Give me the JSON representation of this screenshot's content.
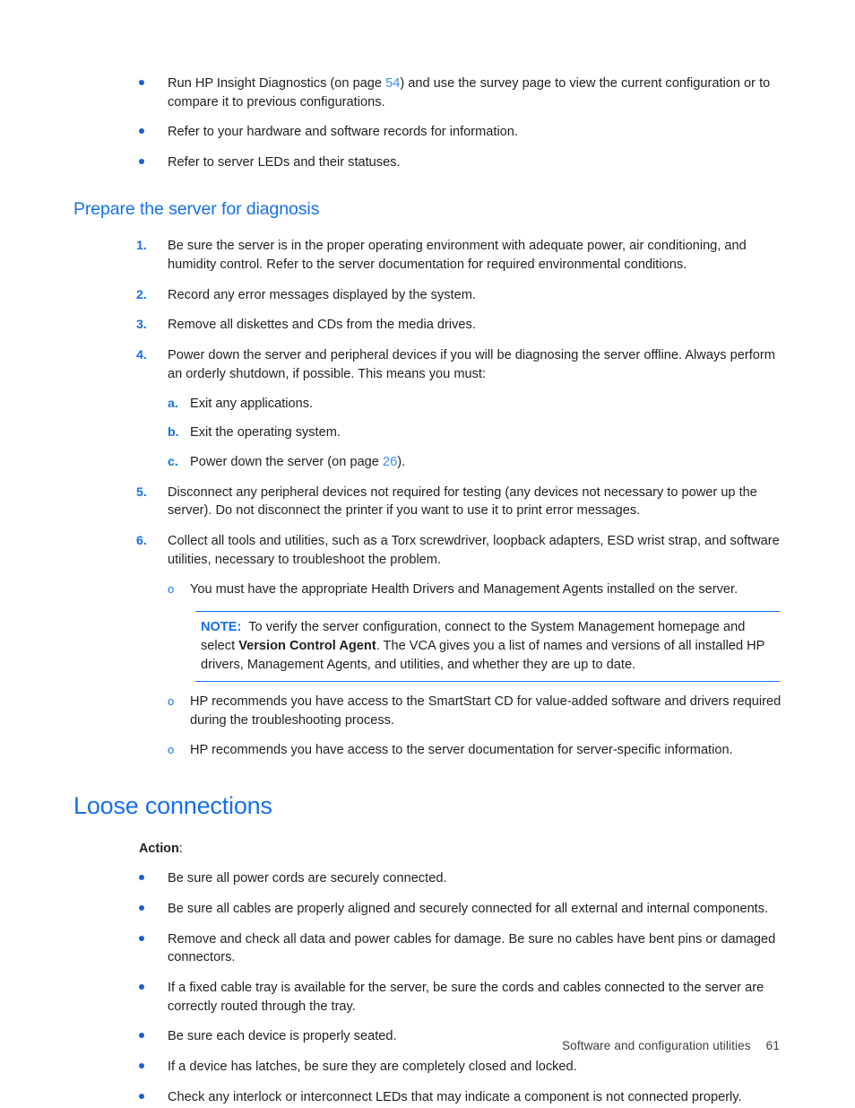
{
  "document": {
    "top_bullets": [
      {
        "pre": "Run HP Insight Diagnostics (on page ",
        "link": "54",
        "post": ") and use the survey page to view the current configuration or to compare it to previous configurations."
      },
      {
        "text": "Refer to your hardware and software records for information."
      },
      {
        "text": "Refer to server LEDs and their statuses."
      }
    ],
    "section_prepare": {
      "heading": "Prepare the server for diagnosis",
      "steps": [
        {
          "marker": "1.",
          "text": "Be sure the server is in the proper operating environment with adequate power, air conditioning, and humidity control. Refer to the server documentation for required environmental conditions."
        },
        {
          "marker": "2.",
          "text": "Record any error messages displayed by the system."
        },
        {
          "marker": "3.",
          "text": "Remove all diskettes and CDs from the media drives."
        },
        {
          "marker": "4.",
          "text": "Power down the server and peripheral devices if you will be diagnosing the server offline. Always perform an orderly shutdown, if possible. This means you must:"
        }
      ],
      "substeps": [
        {
          "marker": "a.",
          "text": "Exit any applications."
        },
        {
          "marker": "b.",
          "text": "Exit the operating system."
        },
        {
          "marker": "c.",
          "pre": "Power down the server (on page ",
          "link": "26",
          "post": ")."
        }
      ],
      "step5": {
        "marker": "5.",
        "text": "Disconnect any peripheral devices not required for testing (any devices not necessary to power up the server). Do not disconnect the printer if you want to use it to print error messages."
      },
      "step6": {
        "marker": "6.",
        "text": "Collect all tools and utilities, such as a Torx screwdriver, loopback adapters, ESD wrist strap, and software utilities, necessary to troubleshoot the problem."
      },
      "sub_bullet_1": {
        "marker": "o",
        "text": "You must have the appropriate Health Drivers and Management Agents installed on the server."
      },
      "note": {
        "label": "NOTE:",
        "part1": "To verify the server configuration, connect to the System Management homepage and select ",
        "bold": "Version Control Agent",
        "part2": ". The VCA gives you a list of names and versions of all installed HP drivers, Management Agents, and utilities, and whether they are up to date."
      },
      "sub_bullet_2": {
        "marker": "o",
        "text": "HP recommends you have access to the SmartStart CD for value-added software and drivers required during the troubleshooting process."
      },
      "sub_bullet_3": {
        "marker": "o",
        "text": "HP recommends you have access to the server documentation for server-specific information."
      }
    },
    "section_loose": {
      "heading": "Loose connections",
      "action_label": "Action",
      "action_colon": ":",
      "bullets": [
        {
          "text": "Be sure all power cords are securely connected."
        },
        {
          "text": "Be sure all cables are properly aligned and securely connected for all external and internal components."
        },
        {
          "text": "Remove and check all data and power cables for damage. Be sure no cables have bent pins or damaged connectors."
        },
        {
          "text": "If a fixed cable tray is available for the server, be sure the cords and cables connected to the server are correctly routed through the tray."
        },
        {
          "text": "Be sure each device is properly seated."
        },
        {
          "text": "If a device has latches, be sure they are completely closed and locked."
        },
        {
          "text": "Check any interlock or interconnect LEDs that may indicate a component is not connected properly."
        }
      ]
    },
    "footer": {
      "chapter": "Software and configuration utilities",
      "page_number": "61"
    },
    "colors": {
      "heading_blue": "#1570ef",
      "link_blue": "#3b8ef0",
      "bullet_blue": "#1a5fd0",
      "body_text": "#231f20"
    }
  }
}
